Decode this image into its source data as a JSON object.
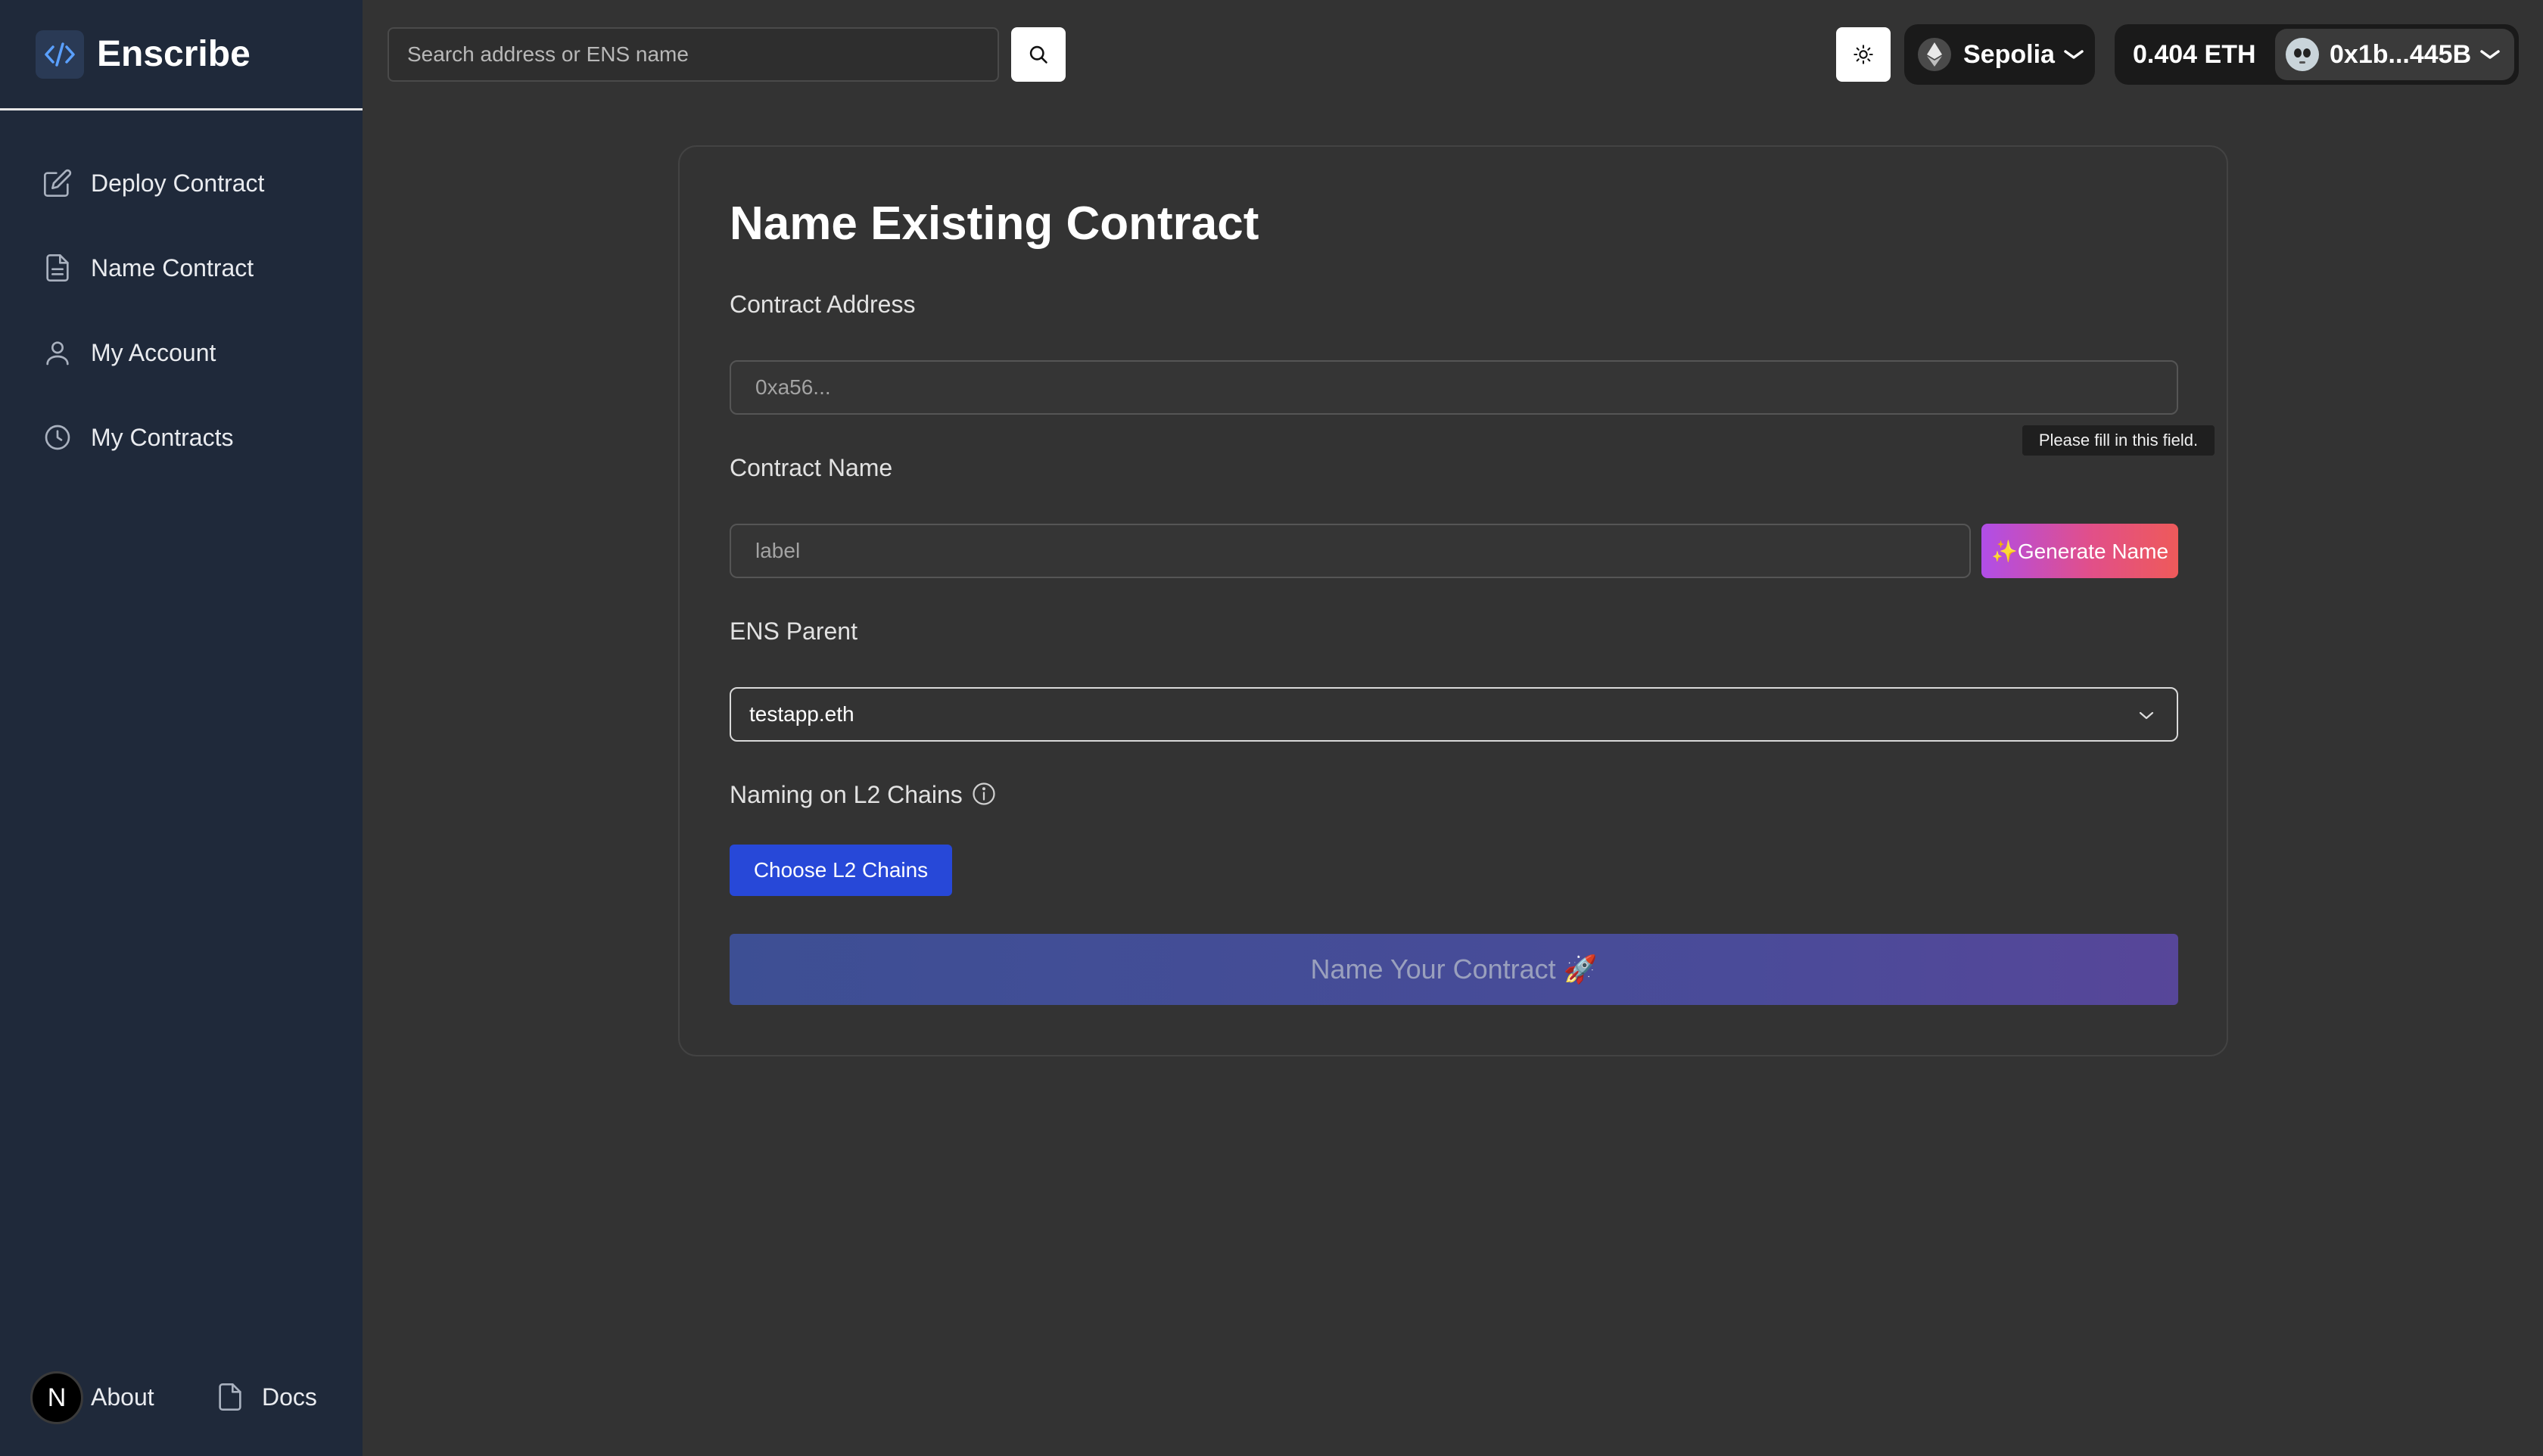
{
  "sidebar": {
    "brand": "Enscribe",
    "items": [
      {
        "label": "Deploy Contract"
      },
      {
        "label": "Name Contract"
      },
      {
        "label": "My Account"
      },
      {
        "label": "My Contracts"
      }
    ],
    "footer": {
      "about_badge": "N",
      "about_label": "About",
      "docs_label": "Docs"
    }
  },
  "topbar": {
    "search_placeholder": "Search address or ENS name",
    "network": "Sepolia",
    "balance": "0.404 ETH",
    "account": "0x1b...445B"
  },
  "form": {
    "title": "Name Existing Contract",
    "address_label": "Contract Address",
    "address_placeholder": "0xa56...",
    "tooltip": "Please fill in this field.",
    "name_label": "Contract Name",
    "name_placeholder": "label",
    "generate_button": "✨Generate Name",
    "parent_label": "ENS Parent",
    "parent_value": "testapp.eth",
    "l2_label": "Naming on L2 Chains",
    "l2_button": "Choose L2 Chains",
    "submit_button": "Name Your Contract 🚀"
  },
  "icons": {
    "nav": [
      "pencil-square-icon",
      "document-icon",
      "user-icon",
      "clock-icon"
    ],
    "search": "search-icon",
    "theme": "sun-icon",
    "network": "ethereum-icon",
    "info": "info-icon"
  },
  "colors": {
    "sidebar_bg": "#1f293a",
    "page_bg": "#333333",
    "primary_button": "#2748d8",
    "generate_gradient_start": "#b04ee8",
    "generate_gradient_end": "#ee5a5a"
  }
}
